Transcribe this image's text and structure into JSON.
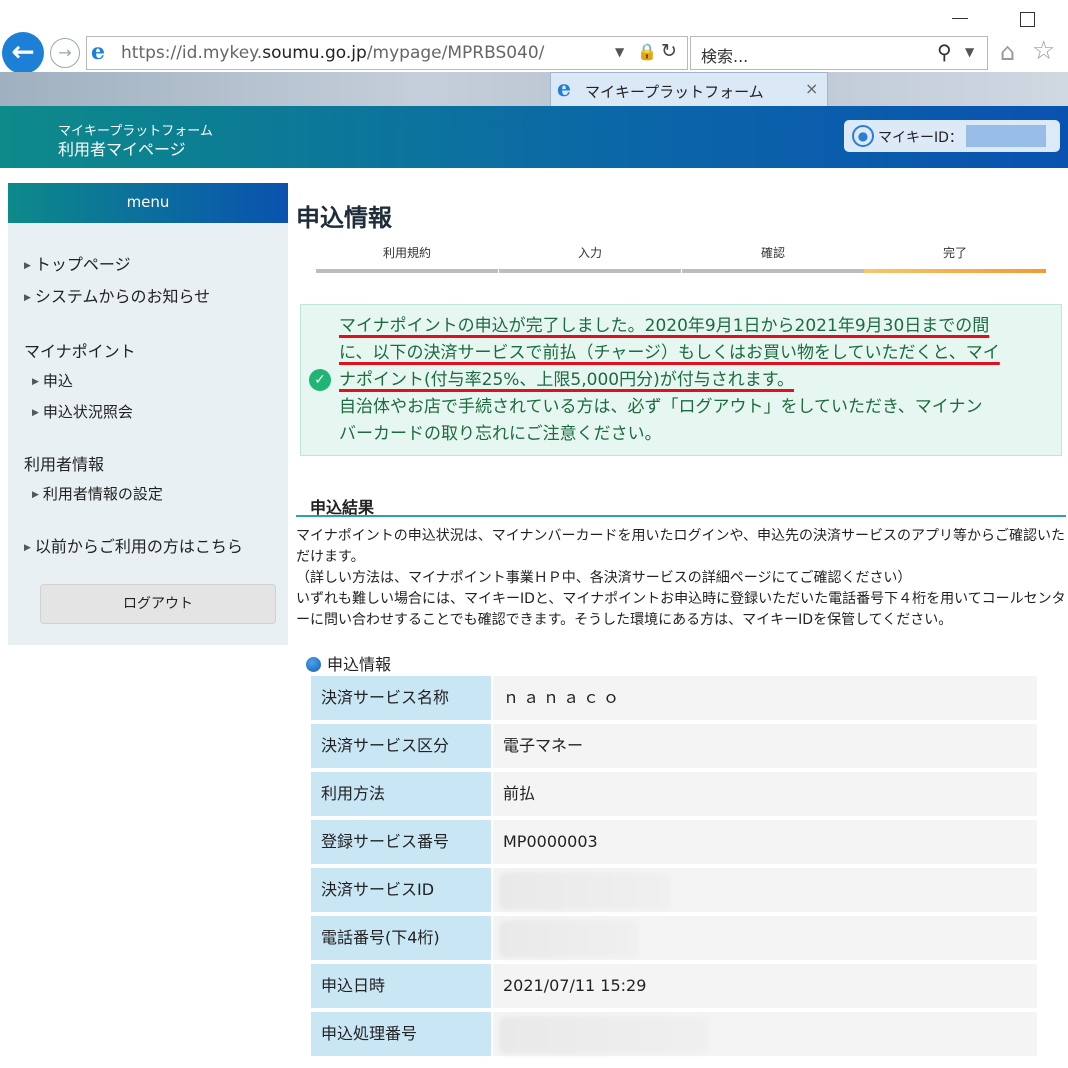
{
  "browser": {
    "url_host": "https://id.mykey.",
    "url_domain": "soumu.go.jp",
    "url_path": "/mypage/MPRBS040/",
    "search_placeholder": "検索...",
    "tab_title": "マイキープラットフォーム",
    "tab_close": "×"
  },
  "header": {
    "brand_small": "マイキープラットフォーム",
    "brand_large": "利用者マイページ",
    "id_label": "マイキーID："
  },
  "sidebar": {
    "menu_label": "menu",
    "top_page": "トップページ",
    "system_notice": "システムからのお知らせ",
    "mynapoint_head": "マイナポイント",
    "apply": "申込",
    "apply_status": "申込状況照会",
    "user_info_head": "利用者情報",
    "user_info_settings": "利用者情報の設定",
    "previous_users": "以前からご利用の方はこちら",
    "logout": "ログアウト"
  },
  "main": {
    "title": "申込情報",
    "steps": [
      "利用規約",
      "入力",
      "確認",
      "完了"
    ],
    "notice_ul1": "マイナポイントの申込が完了しました。2020年9月1日から2021年9月30日までの間",
    "notice_ul2": "に、以下の決済サービスで前払（チャージ）もしくはお買い物をしていただくと、マイ",
    "notice_ul3": "ナポイント(付与率25%、上限5,000円分)が付与されます。",
    "notice_line4": "自治体やお店で手続されている方は、必ず「ログアウト」をしていただき、マイナン",
    "notice_line5": "バーカードの取り忘れにご注意ください。",
    "result_title": "申込結果",
    "result_p1": "マイナポイントの申込状況は、マイナンバーカードを用いたログインや、申込先の決済サービスのアプリ等からご確認いただけます。",
    "result_p2": "（詳しい方法は、マイナポイント事業ＨＰ中、各決済サービスの詳細ページにてご確認ください）",
    "result_p3": "いずれも難しい場合には、マイキーIDと、マイナポイントお申込時に登録いただいた電話番号下４桁を用いてコールセンターに問い合わせすることでも確認できます。そうした環境にある方は、マイキーIDを保管してください。",
    "info_title": "申込情報",
    "table": [
      {
        "key": "決済サービス名称",
        "value": "ｎａｎａｃｏ"
      },
      {
        "key": "決済サービス区分",
        "value": "電子マネー"
      },
      {
        "key": "利用方法",
        "value": "前払"
      },
      {
        "key": "登録サービス番号",
        "value": "MP0000003"
      },
      {
        "key": "決済サービスID",
        "value": ""
      },
      {
        "key": "電話番号(下4桁)",
        "value": ""
      },
      {
        "key": "申込日時",
        "value": "2021/07/11 15:29"
      },
      {
        "key": "申込処理番号",
        "value": ""
      }
    ]
  },
  "icons": [
    "back-arrow-icon",
    "forward-arrow-icon",
    "ie-logo-icon",
    "lock-icon",
    "refresh-icon",
    "search-icon",
    "home-icon",
    "star-icon",
    "user-icon",
    "check-icon"
  ],
  "colors": {
    "header_start": "#0d8a8a",
    "header_end": "#0a52b0",
    "notice_bg": "#e6f7f2",
    "notice_text": "#1d6b3e",
    "table_key_bg": "#c9e6f4",
    "step_active": "#f39a32"
  }
}
